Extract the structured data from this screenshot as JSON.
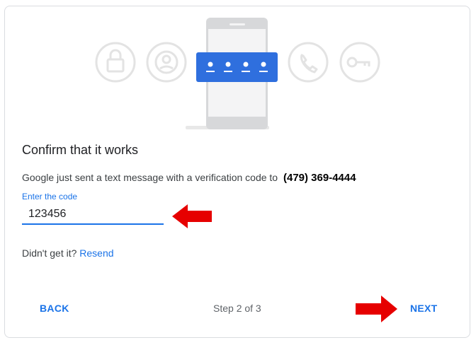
{
  "card": {
    "title": "Confirm that it works",
    "message": "Google just sent a text message with a verification code to",
    "phone_number": "(479) 369-4444",
    "code_label": "Enter the code",
    "code_value": "123456",
    "didnt_get": "Didn't get it?",
    "resend_label": "Resend",
    "back_label": "BACK",
    "step_text": "Step 2 of 3",
    "next_label": "NEXT"
  },
  "hero": {
    "icons": [
      "lock-icon",
      "person-icon",
      "phone-call-icon",
      "key-icon"
    ]
  },
  "annotations": {
    "arrows": [
      "pointing-at-code-field",
      "pointing-at-next-button"
    ],
    "arrow_color": "#e60000"
  },
  "colors": {
    "accent": "#1a73e8",
    "banner": "#2f6fde",
    "border": "#dadce0"
  }
}
